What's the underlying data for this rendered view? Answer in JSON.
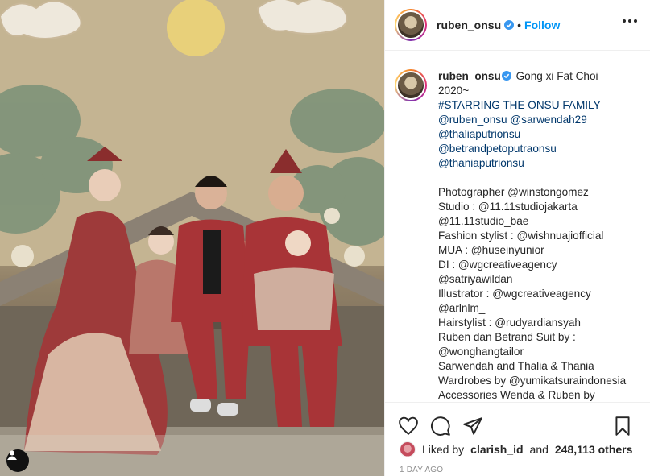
{
  "post": {
    "username": "ruben_onsu",
    "separator": "•",
    "follow_label": "Follow",
    "caption_lines": [
      {
        "text": "Gong xi Fat Choi",
        "kind": "text"
      },
      {
        "text": "2020~",
        "kind": "text"
      },
      {
        "text": "#STARRING THE ONSU FAMILY",
        "kind": "link"
      },
      {
        "text": "@ruben_onsu @sarwendah29",
        "kind": "link"
      },
      {
        "text": "@thaliaputrionsu",
        "kind": "link"
      },
      {
        "text": "@betrandpetoputraonsu",
        "kind": "link"
      },
      {
        "text": "@thaniaputrionsu",
        "kind": "link"
      },
      {
        "text": "",
        "kind": "blank"
      },
      {
        "text": "Photographer @winstongomez",
        "kind": "text"
      },
      {
        "text": "Studio : @11.11studiojakarta",
        "kind": "text"
      },
      {
        "text": "@11.11studio_bae",
        "kind": "text"
      },
      {
        "text": "Fashion stylist : @wishnuajiofficial",
        "kind": "text"
      },
      {
        "text": "MUA : @huseinyunior",
        "kind": "text"
      },
      {
        "text": "DI : @wgcreativeagency",
        "kind": "text"
      },
      {
        "text": "@satriyawildan",
        "kind": "text"
      },
      {
        "text": "Illustrator : @wgcreativeagency",
        "kind": "text"
      },
      {
        "text": "@arlnlm_",
        "kind": "text"
      },
      {
        "text": "Hairstylist : @rudyardiansyah",
        "kind": "text"
      },
      {
        "text": "Ruben dan Betrand Suit by :",
        "kind": "text"
      },
      {
        "text": "@wonghangtailor",
        "kind": "text"
      },
      {
        "text": "Sarwendah and Thalia & Thania",
        "kind": "text"
      },
      {
        "text": "Wardrobes by @yumikatsuraindonesia",
        "kind": "text"
      },
      {
        "text": "Accessories Wenda & Ruben by",
        "kind": "text"
      }
    ],
    "likes": {
      "prefix": "Liked by",
      "user": "clarish_id",
      "joiner": "and",
      "count": "248,113 others"
    },
    "time_ago": "1 DAY AGO"
  },
  "icons": {
    "like": "heart-icon",
    "comment": "comment-icon",
    "share": "share-icon",
    "save": "bookmark-icon",
    "verified": "verified-badge-icon",
    "more": "more-options-icon",
    "tagged": "user-tag-icon"
  },
  "colors": {
    "link": "#00376b",
    "follow": "#0095f6",
    "verified": "#3897f0",
    "muted": "#8e8e8e"
  }
}
